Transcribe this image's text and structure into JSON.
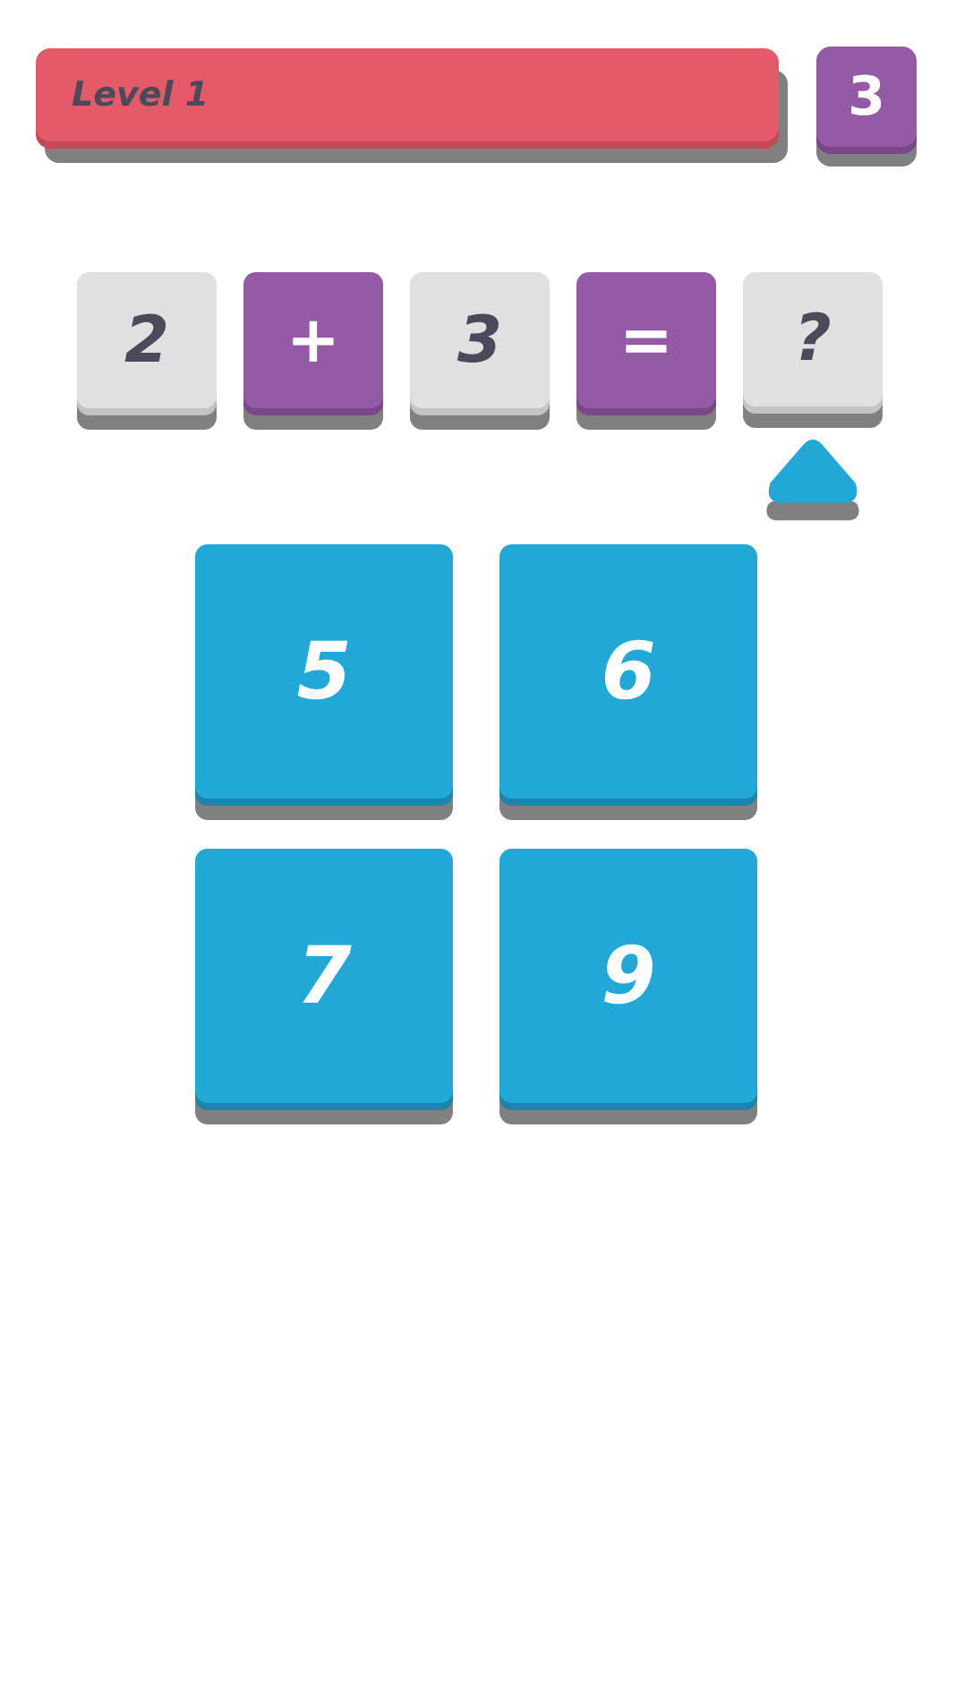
{
  "level_bar": {
    "label": "Level 1"
  },
  "score": "3",
  "equation": [
    {
      "text": "2",
      "kind": "number",
      "selected": false
    },
    {
      "text": "+",
      "kind": "operator",
      "selected": false
    },
    {
      "text": "3",
      "kind": "number",
      "selected": false
    },
    {
      "text": "=",
      "kind": "operator",
      "selected": false
    },
    {
      "text": "?",
      "kind": "number",
      "selected": true
    }
  ],
  "answers": [
    "5",
    "6",
    "7",
    "9"
  ]
}
